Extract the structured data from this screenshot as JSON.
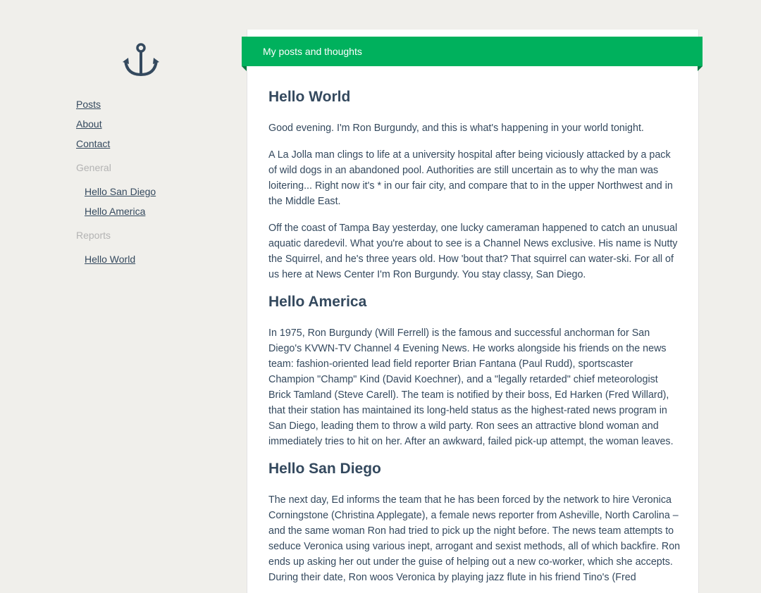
{
  "nav": {
    "links": [
      "Posts",
      "About",
      "Contact"
    ],
    "sections": [
      {
        "title": "General",
        "items": [
          "Hello San Diego",
          "Hello America"
        ]
      },
      {
        "title": "Reports",
        "items": [
          "Hello World"
        ]
      }
    ]
  },
  "header": {
    "title": "My posts and thoughts"
  },
  "posts": [
    {
      "title": "Hello World",
      "paragraphs": [
        "Good evening. I'm Ron Burgundy, and this is what's happening in your world tonight.",
        "A La Jolla man clings to life at a university hospital after being viciously attacked by a pack of wild dogs in an abandoned pool. Authorities are still uncertain as to why the man was loitering... Right now it's * in our fair city, and compare that to in the upper Northwest and in the Middle East.",
        "Off the coast of Tampa Bay yesterday, one lucky cameraman happened to catch an unusual aquatic daredevil. What you're about to see is a Channel News exclusive. His name is Nutty the Squirrel, and he's three years old. How 'bout that? That squirrel can water-ski. For all of us here at News Center I'm Ron Burgundy. You stay classy, San Diego."
      ]
    },
    {
      "title": "Hello America",
      "paragraphs": [
        "In 1975, Ron Burgundy (Will Ferrell) is the famous and successful anchorman for San Diego's KVWN-TV Channel 4 Evening News. He works alongside his friends on the news team: fashion-oriented lead field reporter Brian Fantana (Paul Rudd), sportscaster Champion \"Champ\" Kind (David Koechner), and a \"legally retarded\" chief meteorologist Brick Tamland (Steve Carell). The team is notified by their boss, Ed Harken (Fred Willard), that their station has maintained its long-held status as the highest-rated news program in San Diego, leading them to throw a wild party. Ron sees an attractive blond woman and immediately tries to hit on her. After an awkward, failed pick-up attempt, the woman leaves."
      ]
    },
    {
      "title": "Hello San Diego",
      "paragraphs": [
        "The next day, Ed informs the team that he has been forced by the network to hire Veronica Corningstone (Christina Applegate), a female news reporter from Asheville, North Carolina – and the same woman Ron had tried to pick up the night before. The news team attempts to seduce Veronica using various inept, arrogant and sexist methods, all of which backfire. Ron ends up asking her out under the guise of helping out a new co-worker, which she accepts. During their date, Ron woos Veronica by playing jazz flute in his friend Tino's (Fred"
      ]
    }
  ]
}
